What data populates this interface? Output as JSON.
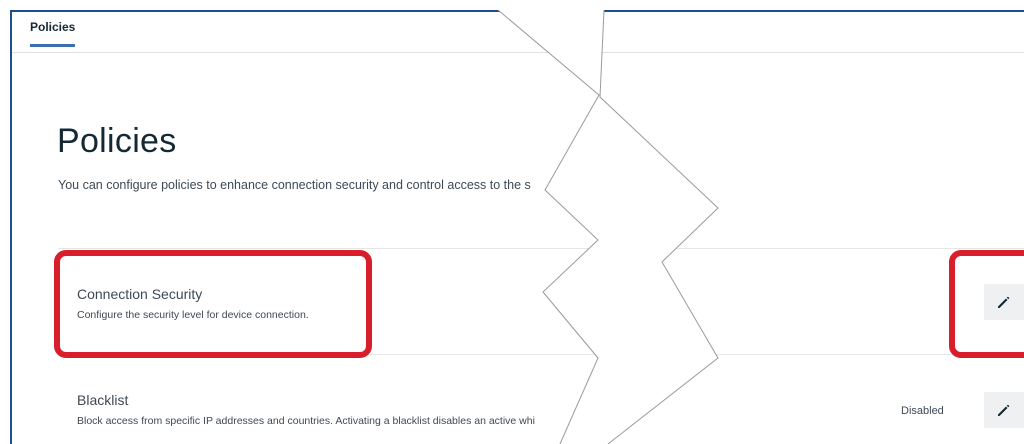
{
  "tabs": [
    {
      "label": "Policies",
      "active": true
    }
  ],
  "page": {
    "title": "Policies",
    "description": "You can configure policies to enhance connection security and control access to the s"
  },
  "policies": [
    {
      "title": "Connection Security",
      "description": "Configure the security level for device connection.",
      "status": "",
      "action_icon": "pencil-icon"
    },
    {
      "title": "Blacklist",
      "description": "Block access from specific IP addresses and countries. Activating a blacklist disables an active whi",
      "status": "Disabled",
      "action_icon": "pencil-icon"
    }
  ],
  "colors": {
    "highlight": "#d81e2a",
    "tab_underline": "#3d70b2",
    "frame_border": "#1f4e8c"
  }
}
